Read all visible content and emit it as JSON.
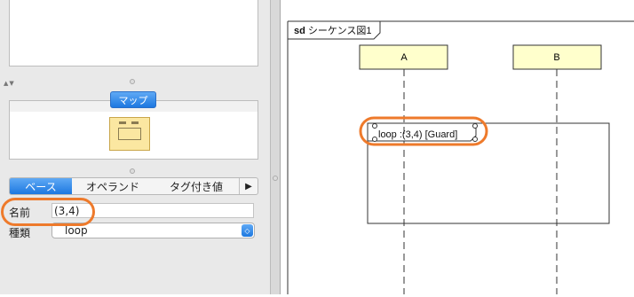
{
  "map_panel": {
    "tab_label": "マップ"
  },
  "properties": {
    "tabs": [
      {
        "label": "ベース",
        "active": true
      },
      {
        "label": "オペランド",
        "active": false
      },
      {
        "label": "タグ付き値",
        "active": false
      }
    ],
    "more_tabs_icon": "play-triangle",
    "name_label": "名前",
    "name_value": "(3,4)",
    "kind_label": "種類",
    "kind_value": "loop"
  },
  "diagram": {
    "frame_keyword": "sd",
    "frame_name": "シーケンス図1",
    "lifelines": [
      "A",
      "B"
    ],
    "fragment_label": "loop :(3,4)  [Guard]"
  },
  "colors": {
    "highlight": "#ee7a2b",
    "lifeline_fill": "#ffffcc",
    "accent": "#2a80e8"
  }
}
